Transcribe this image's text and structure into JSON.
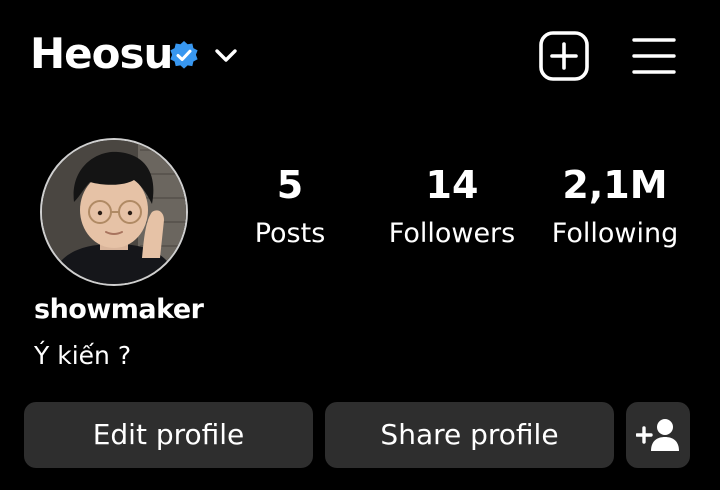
{
  "header": {
    "username": "Heosu",
    "icons": {
      "verified": "verified-badge-icon",
      "dropdown": "chevron-down-icon",
      "create": "plus-square-icon",
      "menu": "hamburger-menu-icon"
    }
  },
  "profile": {
    "avatar_icon": "profile-photo",
    "display_name": "showmaker",
    "bio": "Ý kiến ?"
  },
  "stats": {
    "posts": {
      "value": "5",
      "label": "Posts"
    },
    "followers": {
      "value": "14",
      "label": "Followers"
    },
    "following": {
      "value": "2,1M",
      "label": "Following"
    }
  },
  "actions": {
    "edit_label": "Edit profile",
    "share_label": "Share profile",
    "add_person_icon": "add-person-icon"
  },
  "colors": {
    "background": "#000000",
    "text": "#ffffff",
    "button_bg": "#2e2e2e",
    "verified_blue": "#3897f0"
  }
}
